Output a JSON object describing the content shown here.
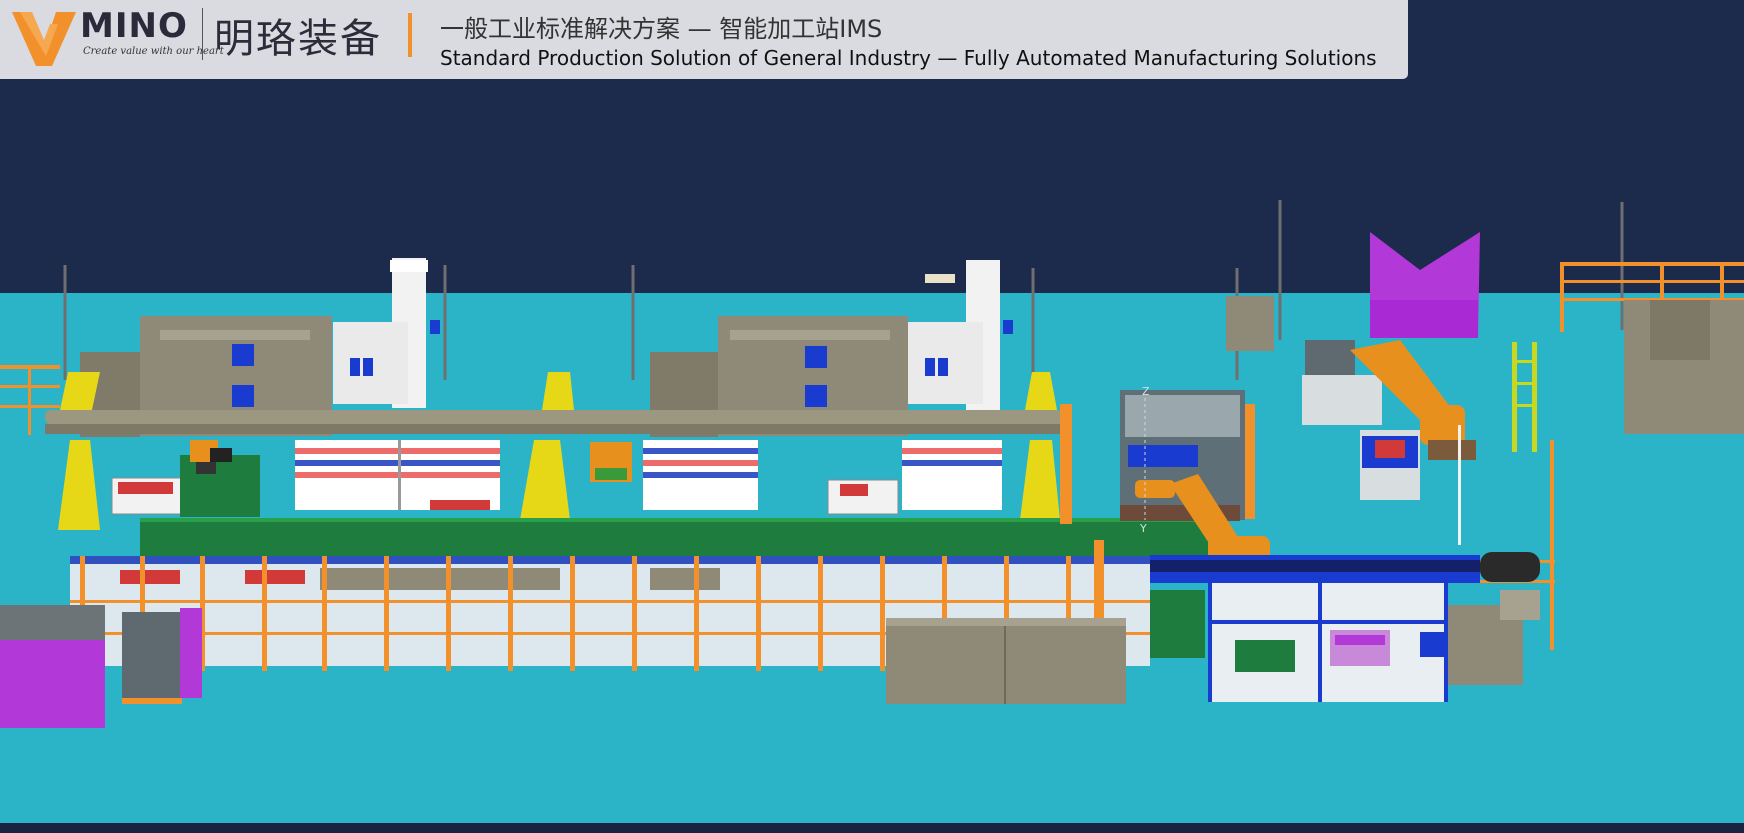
{
  "header": {
    "logo_word": "MINO",
    "logo_tagline": "Create value with our heart",
    "brand_cn": "明珞装备",
    "title_cn": "一般工业标准解决方案 — 智能加工站IMS",
    "title_en": "Standard Production Solution of General Industry — Fully Automated Manufacturing Solutions"
  },
  "scene": {
    "axis_z_label": "Z",
    "axis_y_label": "Y"
  },
  "colors": {
    "sky": "#1c2a4b",
    "floor": "#2bb4c8",
    "accent_orange": "#f2902b",
    "machine_gray": "#8e8a77",
    "conveyor_green": "#1e7d3e",
    "robot_orange": "#e8901e",
    "safety_yellow": "#e6d817",
    "magenta": "#b238d8",
    "blue": "#1a3bd0"
  }
}
